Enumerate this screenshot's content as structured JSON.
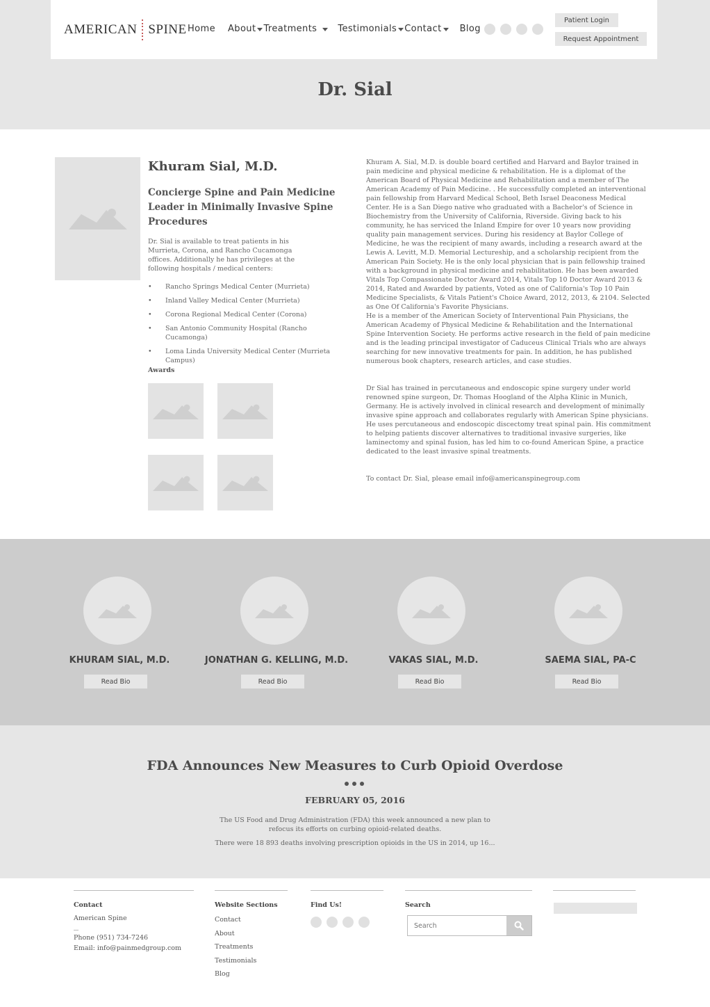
{
  "header": {
    "logo_word1": "AMERICAN",
    "logo_word2": "SPINE",
    "nav": [
      {
        "label": "Home",
        "dropdown": false
      },
      {
        "label": "About",
        "dropdown": true
      },
      {
        "label": "Treatments",
        "dropdown": true
      },
      {
        "label": "Testimonials",
        "dropdown": true
      },
      {
        "label": "Contact",
        "dropdown": true
      },
      {
        "label": "Blog",
        "dropdown": false
      }
    ],
    "social_icons": [
      "social-icon-1",
      "social-icon-2",
      "social-icon-3",
      "social-icon-4"
    ],
    "patient_login": "Patient Login",
    "request_appointment": "Request Appointment"
  },
  "page_title": "Dr. Sial",
  "doctor": {
    "name": "Khuram Sial, M.D.",
    "subtitle": "Concierge Spine and Pain Medicine Leader in Minimally Invasive Spine Procedures",
    "availability": "Dr. Sial is available to treat patients in his Murrieta, Corona, and Rancho Cucamonga offices. Additionally he has privileges at the following hospitals / medical centers:",
    "hospitals": [
      "Rancho Springs Medical Center (Murrieta)",
      "Inland Valley Medical Center (Murrieta)",
      "Corona Regional Medical Center (Corona)",
      "San Antonio Community Hospital (Rancho Cucamonga)",
      "Loma Linda University Medical Center (Murrieta Campus)"
    ],
    "awards_label": "Awards",
    "bio": [
      "Khuram A. Sial, M.D. is double board certified and Harvard and Baylor trained in pain medicine and physical medicine & rehabilitation. He is a diplomat of the American Board of Physical Medicine and Rehabilitation and a member of The American Academy of Pain Medicine. . He successfully completed an interventional pain fellowship from Harvard Medical School, Beth Israel Deaconess Medical Center. He is a San Diego native who graduated with a Bachelor's of Science in Biochemistry from the University of California, Riverside. Giving back to his community, he has serviced the Inland Empire for over 10 years now providing quality pain management services. During his residency at Baylor College of Medicine, he was the recipient of many awards, including a research award at the Lewis A. Levitt, M.D. Memorial Lectureship, and a scholarship recipient from the American Pain Society. He is the only local physician that is pain fellowship trained with a background in physical medicine and rehabilitation.  He has been awarded Vitals Top Compassionate Doctor Award 2014, Vitals Top 10 Doctor Award 2013 & 2014,  Rated and Awarded by patients, Voted as one of California's Top 10 Pain Medicine Specialists, & Vitals Patient's Choice Award, 2012, 2013, & 2104.  Selected as One Of California's Favorite Physicians.",
      "He is a member of the American Society of Interventional Pain Physicians, the American Academy of Physical Medicine & Rehabilitation and the International Spine Intervention Society. He performs active research in the field of pain medicine and is the leading principal investigator of Caduceus Clinical Trials who are always searching for new innovative treatments for pain. In addition, he has published numerous book chapters, research articles, and case studies.",
      "Dr Sial has trained in percutaneous and endoscopic spine surgery under world renowned spine surgeon, Dr. Thomas Hoogland of the Alpha Klinic in Munich, Germany. He is actively involved in clinical research and development of minimally invasive spine approach and collaborates regularly with American Spine physicians. He uses percutaneous and endoscopic discectomy treat spinal pain. His commitment to helping patients discover alternatives to traditional invasive surgeries, like laminectomy and spinal fusion, has led him to co-found American Spine, a practice dedicated to the least invasive spinal treatments.",
      "To contact Dr. Sial, please email info@americanspinegroup.com"
    ]
  },
  "team": [
    {
      "name": "KHURAM SIAL, M.D.",
      "button": "Read Bio"
    },
    {
      "name": "JONATHAN G. KELLING, M.D.",
      "button": "Read Bio"
    },
    {
      "name": "VAKAS SIAL, M.D.",
      "button": "Read Bio"
    },
    {
      "name": "SAEMA SIAL, PA-C",
      "button": "Read Bio"
    }
  ],
  "blog": {
    "title": "FDA Announces New Measures to Curb Opioid Overdose",
    "date": "FEBRUARY 05, 2016",
    "p1": "The US Food and Drug Administration (FDA) this week announced a new plan to refocus its efforts on curbing opioid-related deaths.",
    "p2": "There were 18 893 deaths involving prescription opioids in the US in 2014, up 16..."
  },
  "footer": {
    "contact_head": "Contact",
    "contact_name": "American Spine",
    "contact_phone": "Phone (951) 734-7246",
    "contact_email": "Email: info@painmedgroup.com",
    "sections_head": "Website Sections",
    "sections": [
      "Contact",
      "About",
      "Treatments",
      "Testimonials",
      "Blog"
    ],
    "find_head": "Find Us!",
    "search_head": "Search",
    "search_placeholder": "Search"
  }
}
